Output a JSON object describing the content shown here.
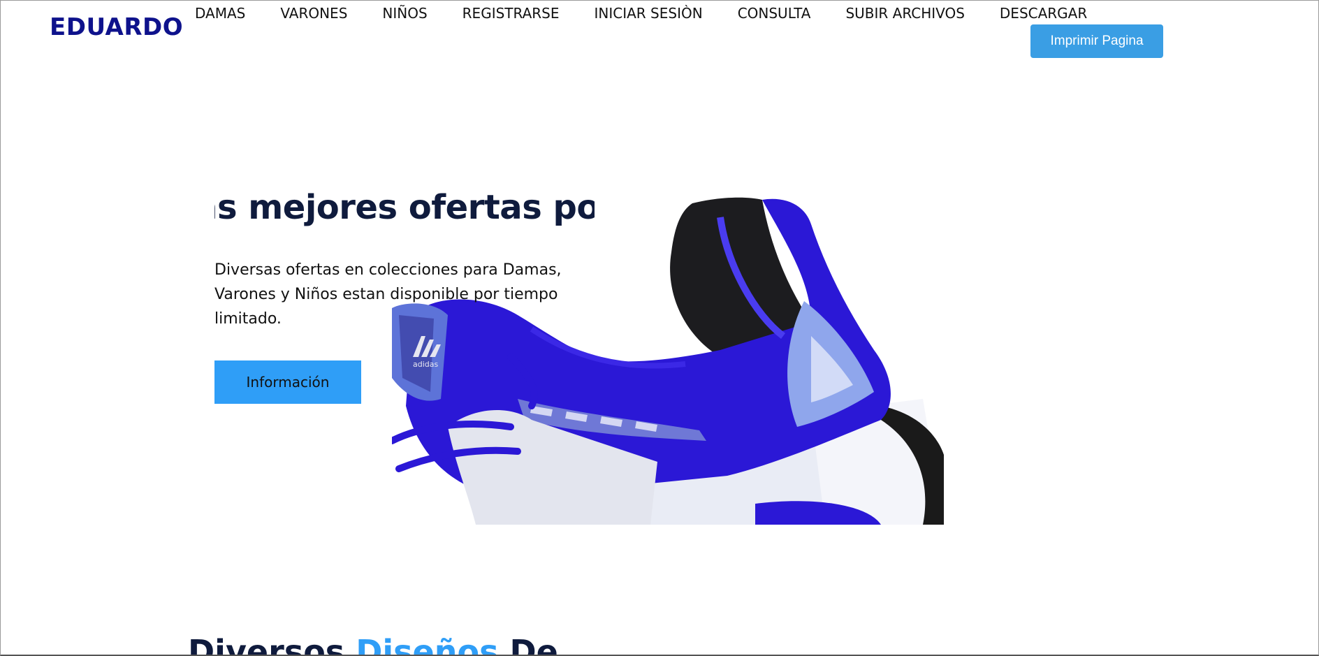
{
  "header": {
    "brand": "EDUARDO",
    "nav": [
      {
        "label": "DAMAS"
      },
      {
        "label": "VARONES"
      },
      {
        "label": "NIÑOS"
      },
      {
        "label": "REGISTRARSE"
      },
      {
        "label": "INICIAR SESIÒN"
      },
      {
        "label": "CONSULTA"
      },
      {
        "label": "SUBIR ARCHIVOS"
      },
      {
        "label": "DESCARGAR"
      }
    ],
    "print_button": "Imprimir Pagina"
  },
  "hero": {
    "title": "Las mejores ofertas por",
    "description": "Diversas ofertas en colecciones para Damas, Varones y Niños estan disponible por tiempo limitado.",
    "button": "Información",
    "image_icon": "sneaker-image"
  },
  "section": {
    "title_part1": "Diversos",
    "title_accent": "Diseños",
    "title_part2": "De"
  },
  "colors": {
    "brand": "#0e128c",
    "accent": "#2f9ef7",
    "print_button": "#3a9ee4",
    "heading": "#0f1b3d",
    "shoe_blue": "#2b18d6"
  }
}
